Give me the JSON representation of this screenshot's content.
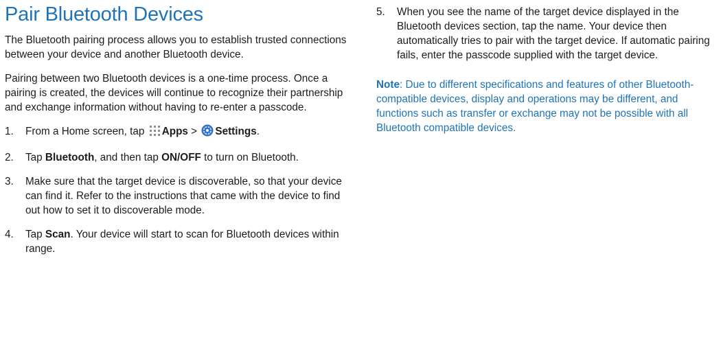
{
  "title": "Pair Bluetooth Devices",
  "intro": [
    "The Bluetooth pairing process allows you to establish trusted connections between your device and another Bluetooth device.",
    "Pairing between two Bluetooth devices is a one-time process. Once a pairing is created, the devices will continue to recognize their partnership and exchange information without having to re-enter a passcode."
  ],
  "steps": {
    "s1": {
      "num": "1.",
      "pre": "From a Home screen, tap ",
      "apps_icon": "apps-grid-icon",
      "apps": "Apps",
      "sep": " > ",
      "settings_icon": "settings-gear-icon",
      "settings": "Settings",
      "end": "."
    },
    "s2": {
      "num": "2.",
      "pre": "Tap ",
      "bluetooth": "Bluetooth",
      "mid": ", and then tap ",
      "onoff": "ON/OFF",
      "end": " to turn on Bluetooth."
    },
    "s3": {
      "num": "3.",
      "text": "Make sure that the target device is discoverable, so that your device can find it. Refer to the instructions that came with the device to find out how to set it to discoverable mode."
    },
    "s4": {
      "num": "4.",
      "pre": "Tap ",
      "scan": "Scan",
      "end": ". Your device will start to scan for Bluetooth devices within range."
    },
    "s5": {
      "num": "5.",
      "text": "When you see the name of the target device displayed in the Bluetooth devices section, tap the name. Your device then automatically tries to pair with the target device. If automatic pairing fails, enter the passcode supplied with the target device."
    }
  },
  "note": {
    "label": "Note",
    "text": ": Due to different specifications and features of other Bluetooth-compatible devices, display and operations may be different, and functions such as transfer or exchange may not be possible with all Bluetooth compatible devices."
  },
  "colors": {
    "accent": "#1f73b7",
    "text": "#1c1c1c"
  }
}
